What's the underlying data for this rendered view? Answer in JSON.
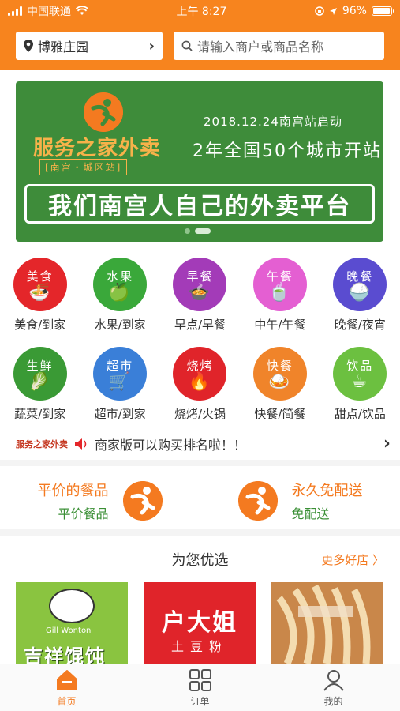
{
  "status_bar": {
    "carrier": "中国联通",
    "time": "上午 8:27",
    "battery": "96%",
    "battery_level": 0.96
  },
  "header": {
    "location": "博雅庄园",
    "search_placeholder": "请输入商户或商品名称"
  },
  "banner": {
    "brand": "服务之家外卖",
    "brand_sub": "[南宫・城区站]",
    "date_line": "2018.12.24南宫站启动",
    "headline": "2年全国50个城市开站",
    "slogan": "我们南宫人自己的外卖平台",
    "slide_count": 2,
    "active_slide": 2
  },
  "categories": [
    {
      "badge": "美食",
      "glyph": "🍜",
      "label": "美食/到家",
      "color": "#e4262a",
      "icon": "noodle-bowl-icon"
    },
    {
      "badge": "水果",
      "glyph": "🍏",
      "label": "水果/到家",
      "color": "#3aa83a",
      "icon": "apple-icon"
    },
    {
      "badge": "早餐",
      "glyph": "🍲",
      "label": "早点/早餐",
      "color": "#a33bb8",
      "icon": "steamer-icon"
    },
    {
      "badge": "午餐",
      "glyph": "🍵",
      "label": "中午/午餐",
      "color": "#e45fd2",
      "icon": "soup-bowl-icon"
    },
    {
      "badge": "晚餐",
      "glyph": "🍚",
      "label": "晚餐/夜宵",
      "color": "#5a4cd0",
      "icon": "rice-bowl-icon"
    },
    {
      "badge": "生鲜",
      "glyph": "🥬",
      "label": "蔬菜/到家",
      "color": "#3a9a35",
      "icon": "vegetable-icon"
    },
    {
      "badge": "超市",
      "glyph": "🛒",
      "label": "超市/到家",
      "color": "#3a7fd8",
      "icon": "cart-icon"
    },
    {
      "badge": "烧烤",
      "glyph": "🔥",
      "label": "烧烤/火锅",
      "color": "#e0242a",
      "icon": "grill-icon"
    },
    {
      "badge": "快餐",
      "glyph": "🍛",
      "label": "快餐/简餐",
      "color": "#f0842a",
      "icon": "fast-food-icon"
    },
    {
      "badge": "饮品",
      "glyph": "☕",
      "label": "甜点/饮品",
      "color": "#6cc040",
      "icon": "drink-cup-icon"
    }
  ],
  "notice": {
    "logo_text": "服务之家外卖",
    "text": "商家版可以购买排名啦！！"
  },
  "promos": [
    {
      "title": "平价的餐品",
      "sub": "平价餐品"
    },
    {
      "title": "永久免配送",
      "sub": "免配送"
    }
  ],
  "section": {
    "title": "为您优选",
    "more": "更多好店 〉"
  },
  "shops": [
    {
      "name": "吉祥馄饨",
      "tag": "Gill Wonton"
    },
    {
      "name": "户大姐",
      "tag": "土豆粉"
    },
    {
      "name": "",
      "tag": ""
    }
  ],
  "tabbar": [
    {
      "label": "首页",
      "icon": "home-icon",
      "active": true
    },
    {
      "label": "订单",
      "icon": "grid-icon",
      "active": false
    },
    {
      "label": "我的",
      "icon": "user-icon",
      "active": false
    }
  ]
}
